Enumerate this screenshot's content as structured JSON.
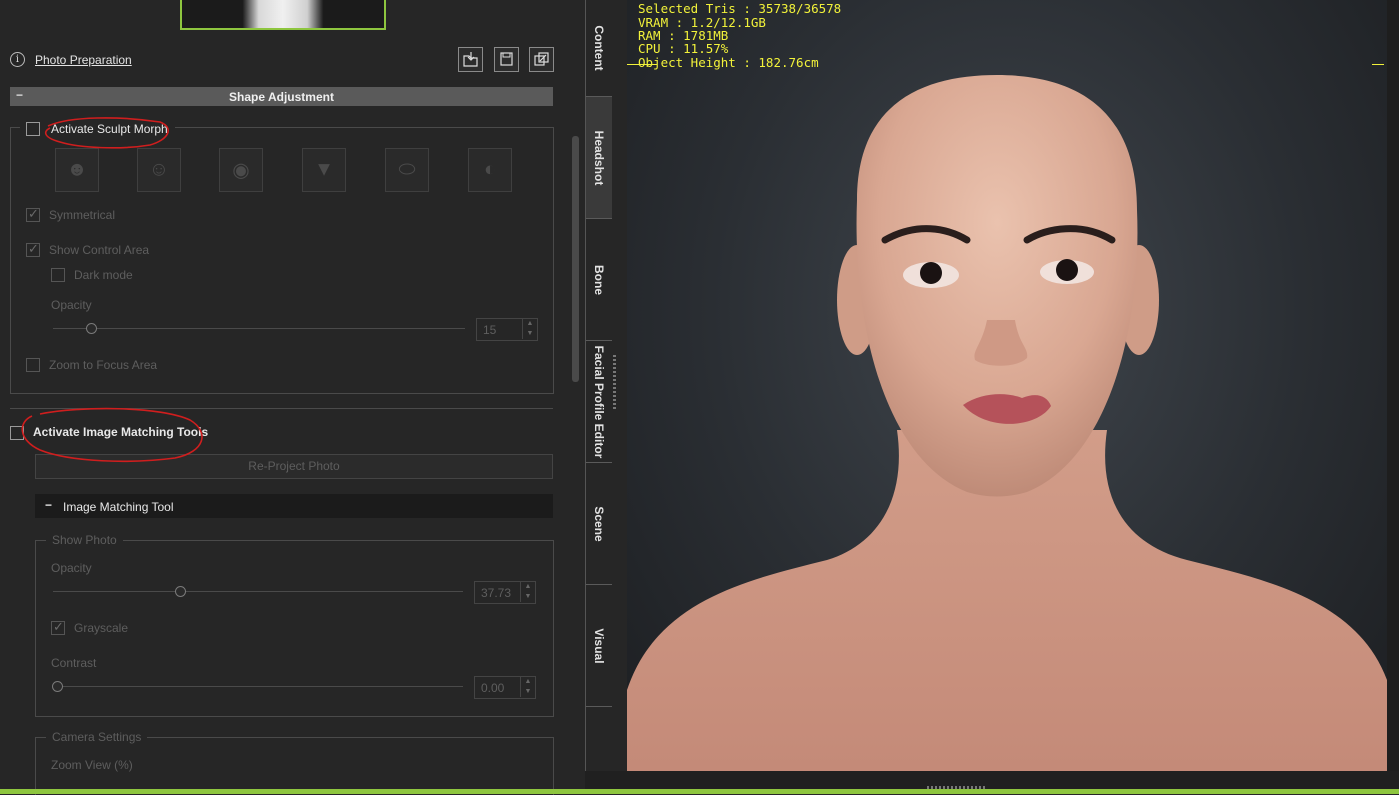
{
  "header": {
    "photo_preparation": "Photo Preparation"
  },
  "shape_adjustment": {
    "title": "Shape Adjustment",
    "activate_sculpt_morph": "Activate Sculpt Morph",
    "symmetrical": "Symmetrical",
    "show_control_area": "Show Control Area",
    "dark_mode": "Dark mode",
    "opacity_label": "Opacity",
    "opacity_value": "15",
    "zoom_to_focus_area": "Zoom to Focus Area"
  },
  "image_matching": {
    "activate_label": "Activate Image Matching Tools",
    "reproject_button": "Re-Project Photo",
    "tool_title": "Image Matching Tool",
    "show_photo": "Show Photo",
    "opacity_label": "Opacity",
    "opacity_value": "37.73",
    "grayscale": "Grayscale",
    "contrast_label": "Contrast",
    "contrast_value": "0.00",
    "camera_settings": "Camera Settings",
    "zoom_view": "Zoom View (%)"
  },
  "tabs": [
    "Content",
    "Headshot",
    "Bone",
    "Facial Profile Editor",
    "Scene",
    "Visual"
  ],
  "active_tab": "Headshot",
  "stats": {
    "selected_tris": "Selected Tris : 35738/36578",
    "vram": "VRAM : 1.2/12.1GB",
    "ram": "RAM : 1781MB",
    "cpu": "CPU : 11.57%",
    "object_height": "Object Height : 182.76cm"
  },
  "colors": {
    "accent_green": "#8ec63f",
    "stats_yellow": "#f2f23a",
    "annotation_red": "#d01e1e"
  }
}
